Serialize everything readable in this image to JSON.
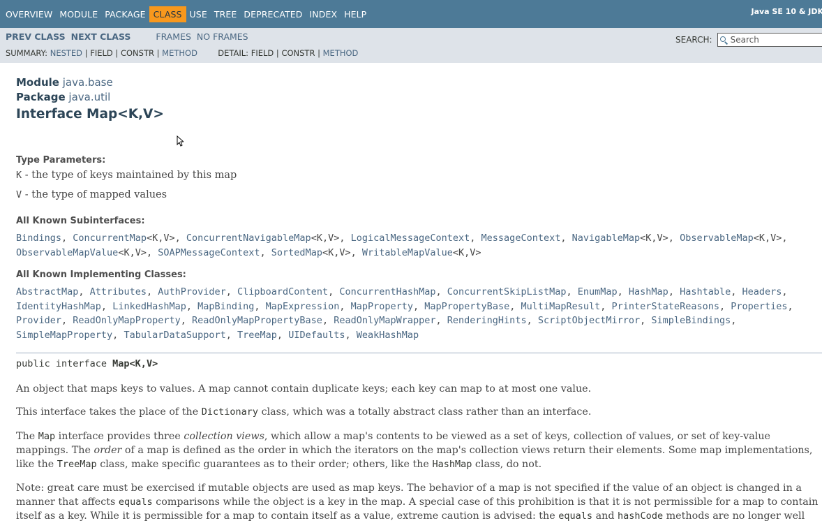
{
  "topnav": {
    "items": [
      "OVERVIEW",
      "MODULE",
      "PACKAGE",
      "CLASS",
      "USE",
      "TREE",
      "DEPRECATED",
      "INDEX",
      "HELP"
    ],
    "active_index": 3,
    "about_language": "Java SE 10 & JDK"
  },
  "subnav": {
    "prev_class": "PREV CLASS",
    "next_class": "NEXT CLASS",
    "frames": "FRAMES",
    "no_frames": "NO FRAMES",
    "summary_label": "SUMMARY:",
    "summary_nested": "NESTED",
    "summary_field": "FIELD",
    "summary_constr": "CONSTR",
    "summary_method": "METHOD",
    "detail_label": "DETAIL:",
    "detail_field": "FIELD",
    "detail_constr": "CONSTR",
    "detail_method": "METHOD",
    "search_label": "SEARCH:",
    "search_placeholder": "Search"
  },
  "header": {
    "module_label": "Module",
    "module_value": "java.base",
    "package_label": "Package",
    "package_value": "java.util",
    "title": "Interface Map<K,V>"
  },
  "type_params": {
    "heading": "Type Parameters:",
    "k_name": "K",
    "k_desc": " - the type of keys maintained by this map",
    "v_name": "V",
    "v_desc": " - the type of mapped values"
  },
  "subinterfaces": {
    "heading": "All Known Subinterfaces:",
    "line1": [
      [
        "Bindings",
        ", "
      ],
      [
        "ConcurrentMap",
        "<K,V>, "
      ],
      [
        "ConcurrentNavigableMap",
        "<K,V>, "
      ],
      [
        "LogicalMessageContext",
        ", "
      ],
      [
        "MessageContext",
        ", "
      ],
      [
        "NavigableMap",
        "<K,V>, "
      ],
      [
        "ObservableMap",
        "<K,V>,"
      ]
    ],
    "line2": [
      [
        "ObservableMapValue",
        "<K,V>, "
      ],
      [
        "SOAPMessageContext",
        ", "
      ],
      [
        "SortedMap",
        "<K,V>, "
      ],
      [
        "WritableMapValue",
        "<K,V>"
      ]
    ]
  },
  "implementing": {
    "heading": "All Known Implementing Classes:",
    "line1": [
      "AbstractMap",
      "Attributes",
      "AuthProvider",
      "ClipboardContent",
      "ConcurrentHashMap",
      "ConcurrentSkipListMap",
      "EnumMap",
      "HashMap",
      "Hashtable",
      "Headers"
    ],
    "line2": [
      "IdentityHashMap",
      "LinkedHashMap",
      "MapBinding",
      "MapExpression",
      "MapProperty",
      "MapPropertyBase",
      "MultiMapResult",
      "PrinterStateReasons",
      "Properties"
    ],
    "line3": [
      "Provider",
      "ReadOnlyMapProperty",
      "ReadOnlyMapPropertyBase",
      "ReadOnlyMapWrapper",
      "RenderingHints",
      "ScriptObjectMirror",
      "SimpleBindings"
    ],
    "line4": [
      "SimpleMapProperty",
      "TabularDataSupport",
      "TreeMap",
      "UIDefaults",
      "WeakHashMap"
    ]
  },
  "signature": {
    "prefix": "public interface ",
    "name": "Map<K,V>"
  },
  "description": {
    "p1": "An object that maps keys to values. A map cannot contain duplicate keys; each key can map to at most one value.",
    "p2_a": "This interface takes the place of the ",
    "p2_code": "Dictionary",
    "p2_b": " class, which was a totally abstract class rather than an interface.",
    "p3_a": "The ",
    "p3_code1": "Map",
    "p3_b": " interface provides three ",
    "p3_em1": "collection views",
    "p3_c": ", which allow a map's contents to be viewed as a set of keys, collection of values, or set of key-value mappings. The ",
    "p3_em2": "order",
    "p3_d": " of a map is defined as the order in which the iterators on the map's collection views return their elements. Some map implementations, like the ",
    "p3_code2": "TreeMap",
    "p3_e": " class, make specific guarantees as to their order; others, like the ",
    "p3_code3": "HashMap",
    "p3_f": " class, do not.",
    "p4_a": "Note: great care must be exercised if mutable objects are used as map keys. The behavior of a map is not specified if the value of an object is changed in a manner that affects ",
    "p4_code1": "equals",
    "p4_b": " comparisons while the object is a key in the map. A special case of this prohibition is that it is not permissible for a map to contain itself as a key. While it is permissible for a map to contain itself as a value, extreme caution is advised: the ",
    "p4_code2": "equals",
    "p4_c": " and ",
    "p4_code3": "hashCode",
    "p4_d": " methods are no longer well"
  }
}
